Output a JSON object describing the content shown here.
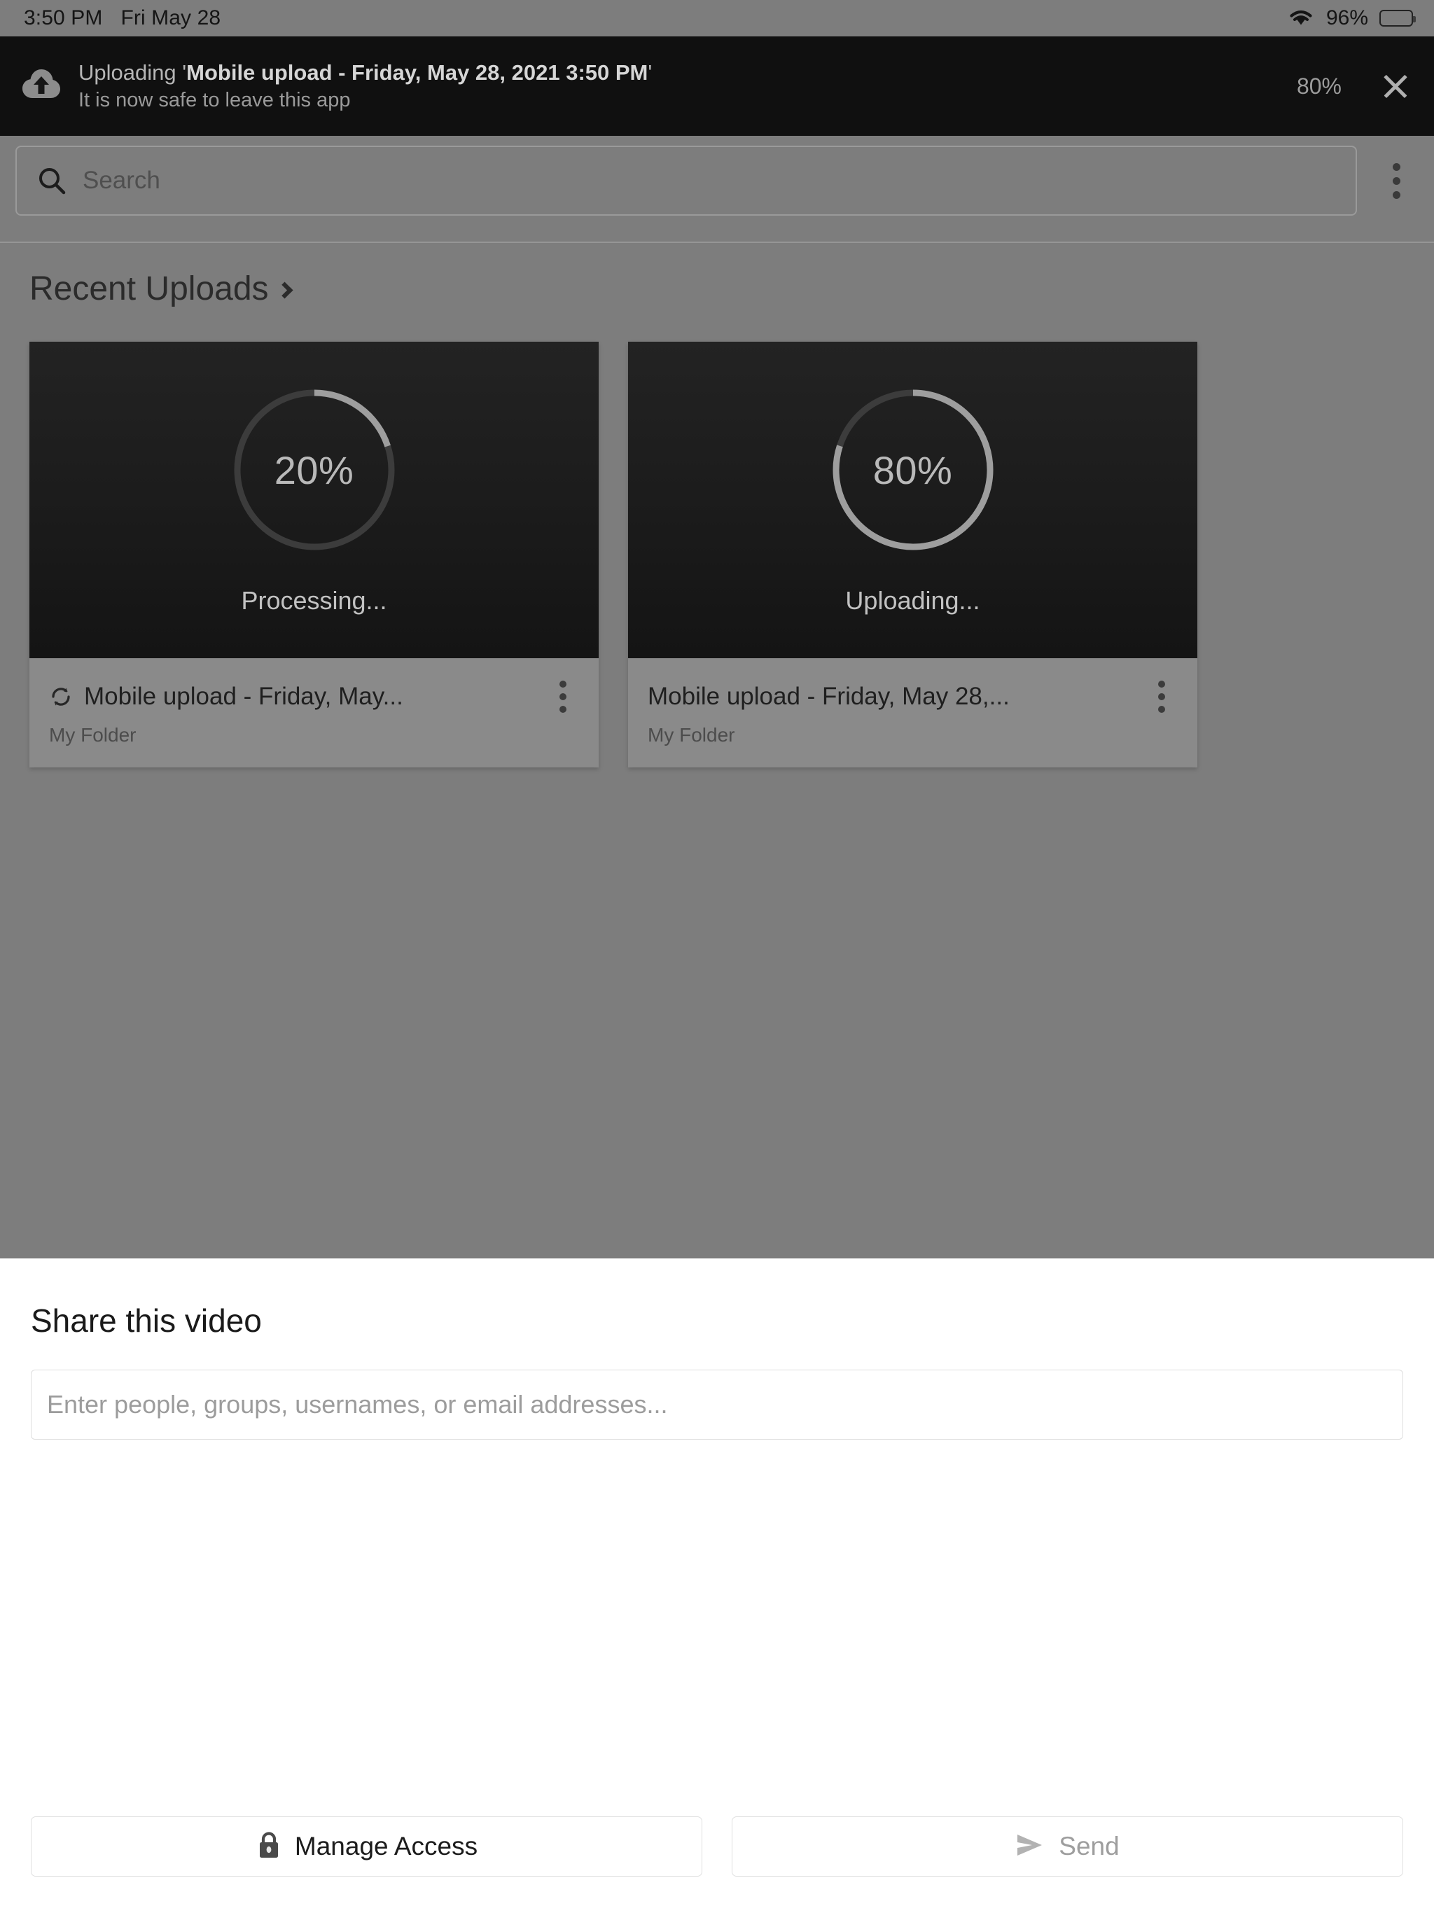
{
  "status_bar": {
    "time": "3:50 PM",
    "date": "Fri May 28",
    "battery_percent": "96%",
    "wifi_icon": "wifi-icon",
    "battery_icon": "battery-icon"
  },
  "upload_banner": {
    "icon": "cloud-upload-icon",
    "prefix": "Uploading '",
    "filename": "Mobile upload - Friday, May 28, 2021 3:50 PM",
    "suffix": "'",
    "subtitle": "It is now safe to leave this app",
    "percent": "80%",
    "close_icon": "close-icon"
  },
  "search": {
    "placeholder": "Search",
    "icon": "search-icon",
    "overflow_icon": "overflow-menu-icon"
  },
  "recent": {
    "title": "Recent Uploads",
    "chevron_icon": "chevron-right-icon",
    "cards": [
      {
        "percent_label": "20%",
        "percent_value": 20,
        "status": "Processing...",
        "title": "Mobile upload - Friday, May...",
        "folder": "My Folder",
        "has_sync_icon": true,
        "sync_icon": "sync-icon",
        "overflow_icon": "overflow-menu-icon"
      },
      {
        "percent_label": "80%",
        "percent_value": 80,
        "status": "Uploading...",
        "title": "Mobile upload - Friday, May 28,...",
        "folder": "My Folder",
        "has_sync_icon": false,
        "sync_icon": "",
        "overflow_icon": "overflow-menu-icon"
      }
    ]
  },
  "share_sheet": {
    "title": "Share this video",
    "input_placeholder": "Enter people, groups, usernames, or email addresses...",
    "input_value": "",
    "manage_access_label": "Manage Access",
    "manage_access_icon": "lock-icon",
    "send_label": "Send",
    "send_icon": "send-icon",
    "send_disabled": true
  },
  "colors": {
    "dim_overlay": "#7d7d7d",
    "banner_bg": "#101010",
    "thumb_bg": "#1b1b1b",
    "sheet_bg": "#ffffff",
    "progress_track": "#3c3c3c",
    "progress_arc": "#9e9e9e"
  }
}
